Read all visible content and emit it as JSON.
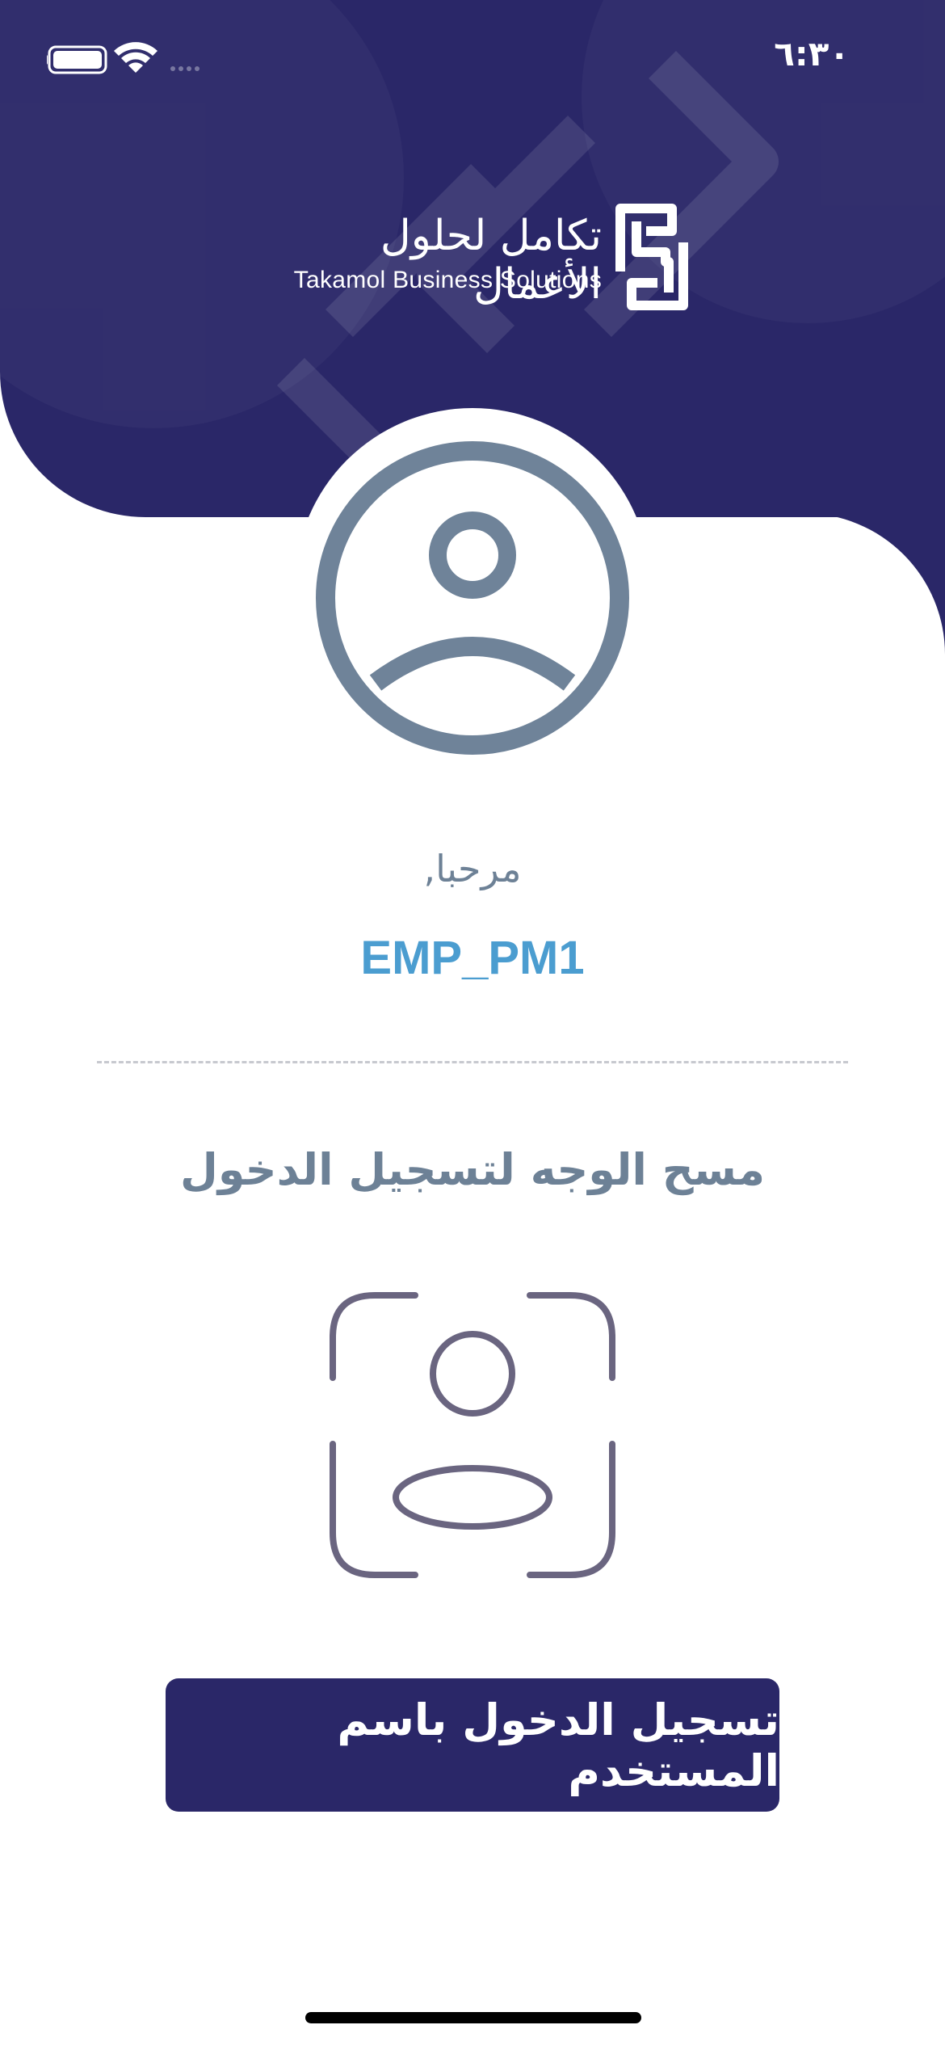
{
  "status_bar": {
    "time": "٦:٣٠"
  },
  "brand": {
    "arabic_name": "تكامل لحلول الأعمال",
    "english_name": "Takamol Business Solutions"
  },
  "welcome": {
    "greeting": "مرحبا,",
    "username": "EMP_PM1"
  },
  "face_login": {
    "title": "مسح الوجه لتسجيل الدخول",
    "icon": "face-id-icon"
  },
  "actions": {
    "username_login_label": "تسجيل الدخول باسم المستخدم"
  },
  "colors": {
    "primary": "#2a2768",
    "username": "#4b9dd0",
    "muted_text": "#6d8196",
    "avatar": "#6f8399",
    "face_icon": "#6a6580"
  }
}
